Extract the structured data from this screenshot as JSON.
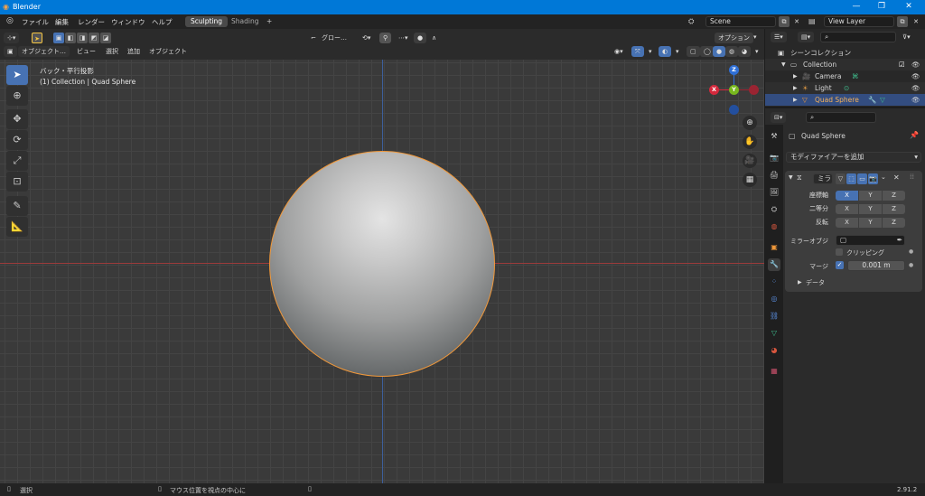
{
  "window": {
    "title": "Blender",
    "minimize": "—",
    "maximize": "❐",
    "close": "✕"
  },
  "menu": {
    "items": [
      "ファイル",
      "編集",
      "レンダー",
      "ウィンドウ",
      "ヘルプ"
    ],
    "workspace_tabs": [
      "Sculpting",
      "Shading"
    ],
    "add_tab": "+",
    "scene": "Scene",
    "view_layer": "View Layer"
  },
  "viewport_header": {
    "mode": "オブジェクト…",
    "menus": [
      "ビュー",
      "選択",
      "追加",
      "オブジェクト"
    ],
    "orientation": "グロー…",
    "options": "オプション"
  },
  "viewport": {
    "view_name": "バック・平行投影",
    "collection_info": "(1) Collection | Quad Sphere",
    "gizmo": {
      "z": "Z",
      "x": "X",
      "y": "Y"
    }
  },
  "status": {
    "left": "選択",
    "middle": "マウス位置を視点の中心に",
    "version": "2.91.2"
  },
  "outliner": {
    "scene_collection": "シーンコレクション",
    "items": [
      {
        "label": "Collection"
      },
      {
        "label": "Camera"
      },
      {
        "label": "Light"
      },
      {
        "label": "Quad Sphere"
      }
    ]
  },
  "properties": {
    "object_name": "Quad Sphere",
    "add_modifier": "モディファイアーを追加",
    "modifier_name": "ミラ",
    "rows": [
      {
        "label": "座標軸",
        "buttons": [
          "X",
          "Y",
          "Z"
        ],
        "active": 0
      },
      {
        "label": "二等分",
        "buttons": [
          "X",
          "Y",
          "Z"
        ],
        "active": -1
      },
      {
        "label": "反転",
        "buttons": [
          "X",
          "Y",
          "Z"
        ],
        "active": -1
      }
    ],
    "mirror_object_label": "ミラーオブジ",
    "clipping_label": "クリッピング",
    "merge_label": "マージ",
    "merge_value": "0.001 m",
    "data_label": "データ"
  },
  "colors": {
    "accent": "#4772b3",
    "selection": "#f0983a",
    "titlebar": "#0078d7"
  }
}
